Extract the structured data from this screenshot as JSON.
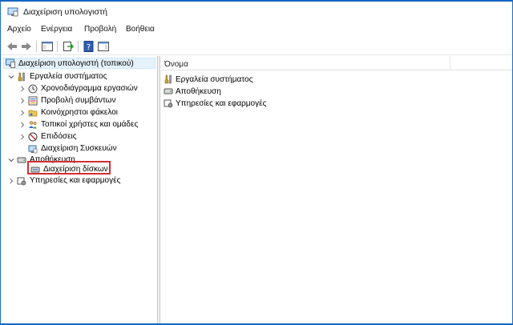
{
  "window": {
    "title": "Διαχείριση υπολογιστή"
  },
  "menubar": {
    "items": [
      "Αρχείο",
      "Ενέργεια",
      "Προβολή",
      "Βοήθεια"
    ]
  },
  "toolbar": {
    "icons": [
      "back-arrow-icon",
      "forward-arrow-icon",
      "show-hide-console-tree-icon",
      "export-list-icon",
      "help-icon",
      "show-hide-action-pane-icon"
    ]
  },
  "tree": {
    "root": "Διαχείριση υπολογιστή (τοπικού)",
    "system_tools": "Εργαλεία συστήματος",
    "task_scheduler": "Χρονοδιάγραμμα εργασιών",
    "event_viewer": "Προβολή συμβάντων",
    "shared_folders": "Κοινόχρηστοι φάκελοι",
    "local_users": "Τοπικοί χρήστες και ομάδες",
    "performance": "Επιδόσεις",
    "device_manager": "Διαχείριση Συσκευών",
    "storage": "Αποθήκευση",
    "disk_management": "Διαχείριση δίσκων",
    "services": "Υπηρεσίες και εφαρμογές"
  },
  "list": {
    "column_name": "Όνομα",
    "items": [
      "Εργαλεία συστήματος",
      "Αποθήκευση",
      "Υπηρεσίες και εφαρμογές"
    ]
  },
  "colors": {
    "window_border": "#1565c0",
    "selection_bg": "#e5f1fb",
    "highlight_box": "#d32f2f"
  }
}
